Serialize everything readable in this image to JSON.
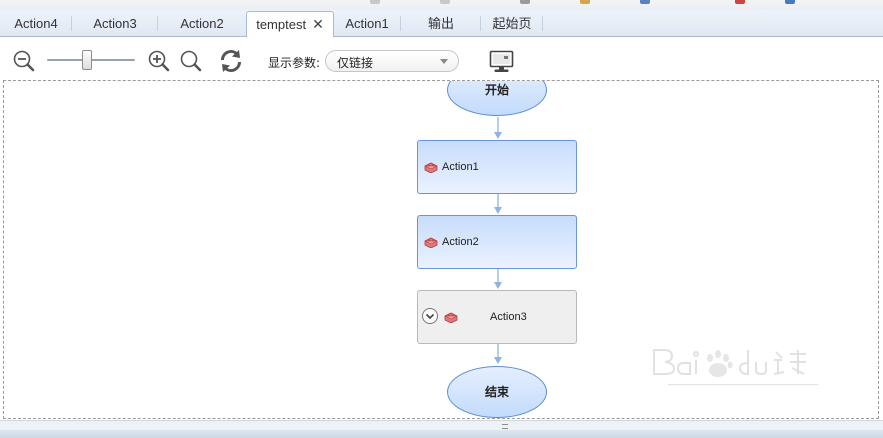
{
  "tabs": [
    {
      "label": "Action4"
    },
    {
      "label": "Action3"
    },
    {
      "label": "Action2"
    },
    {
      "label": "temptest",
      "active": true,
      "closable": true
    },
    {
      "label": "Action1"
    },
    {
      "label": "输出"
    },
    {
      "label": "起始页"
    }
  ],
  "toolbar": {
    "zoom_slider_level": 0.45,
    "param_label": "显示参数:",
    "param_select_value": "仅链接",
    "icons": [
      "zoom-out-icon",
      "zoom-in-icon",
      "zoom-reset-icon",
      "refresh-icon",
      "monitor-icon"
    ]
  },
  "flow": {
    "start_label": "开始",
    "end_label": "结束",
    "nodes": [
      {
        "label": "Action1",
        "style": "blue"
      },
      {
        "label": "Action2",
        "style": "blue"
      },
      {
        "label": "Action3",
        "style": "grey",
        "expandable": true
      }
    ]
  },
  "colors": {
    "node_border": "#6a97d4",
    "node_fill": "#c7dcfb",
    "connector": "#8fb4e3",
    "brick_icon": "#d9534f"
  }
}
